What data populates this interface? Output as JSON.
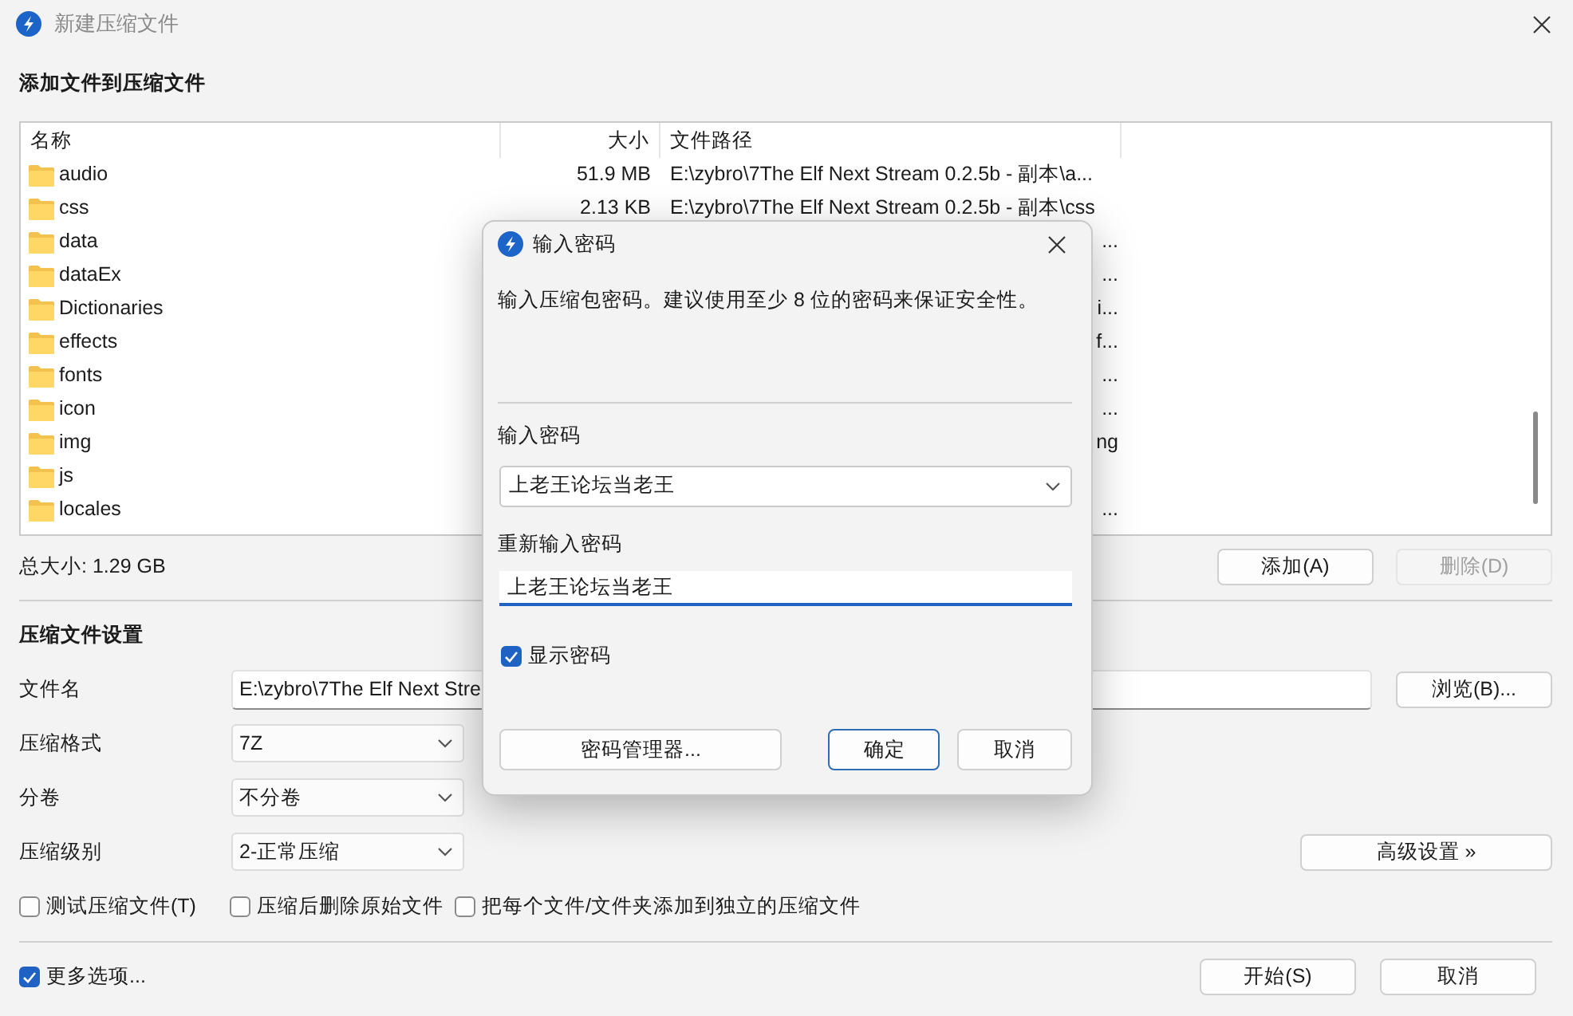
{
  "window": {
    "title": "新建压缩文件"
  },
  "add_section": {
    "heading": "添加文件到压缩文件",
    "columns": [
      "名称",
      "大小",
      "文件路径"
    ],
    "rows": [
      {
        "name": "audio",
        "size": "51.9 MB",
        "path": "E:\\zybro\\7The Elf Next Stream 0.2.5b - 副本\\a..."
      },
      {
        "name": "css",
        "size": "2.13 KB",
        "path": "E:\\zybro\\7The Elf Next Stream 0.2.5b - 副本\\css"
      },
      {
        "name": "data",
        "path_tail": "..."
      },
      {
        "name": "dataEx",
        "path_tail": "..."
      },
      {
        "name": "Dictionaries",
        "path_tail": "i..."
      },
      {
        "name": "effects",
        "path_tail": "f..."
      },
      {
        "name": "fonts",
        "path_tail": "..."
      },
      {
        "name": "icon",
        "path_tail": "..."
      },
      {
        "name": "img",
        "path_tail": "ng"
      },
      {
        "name": "js"
      },
      {
        "name": "locales",
        "path_tail": "..."
      }
    ],
    "total": "总大小: 1.29 GB",
    "buttons": [
      {
        "label": "添加(A)",
        "disabled": false
      },
      {
        "label": "删除(D)",
        "disabled": true
      }
    ]
  },
  "settings": {
    "heading": "压缩文件设置",
    "filename": {
      "label": "文件名",
      "value": "E:\\zybro\\7The Elf Next Stre"
    },
    "browse": "浏览(B)...",
    "selects": [
      {
        "label": "压缩格式",
        "value": "7Z"
      },
      {
        "label": "分卷",
        "value": "不分卷"
      },
      {
        "label": "压缩级别",
        "value": "2-正常压缩"
      }
    ],
    "advanced": "高级设置 »",
    "options": [
      {
        "label": "测试压缩文件(T)",
        "checked": false
      },
      {
        "label": "压缩后删除原始文件",
        "checked": false
      },
      {
        "label": "把每个文件/文件夹添加到独立的压缩文件",
        "checked": false
      }
    ]
  },
  "footer": {
    "more_options": {
      "label": "更多选项...",
      "checked": true
    },
    "buttons": [
      "开始(S)",
      "取消"
    ]
  },
  "password_dialog": {
    "title": "输入密码",
    "description": "输入压缩包密码。建议使用至少 8 位的密码来保证安全性。",
    "password_label": "输入密码",
    "password": "上老王论坛当老王",
    "confirm_label": "重新输入密码",
    "confirm": "上老王论坛当老王",
    "show_password": {
      "label": "显示密码",
      "checked": true
    },
    "buttons": [
      {
        "label": "密码管理器...",
        "default": false
      },
      {
        "label": "确定",
        "default": true
      },
      {
        "label": "取消",
        "default": false
      }
    ]
  }
}
